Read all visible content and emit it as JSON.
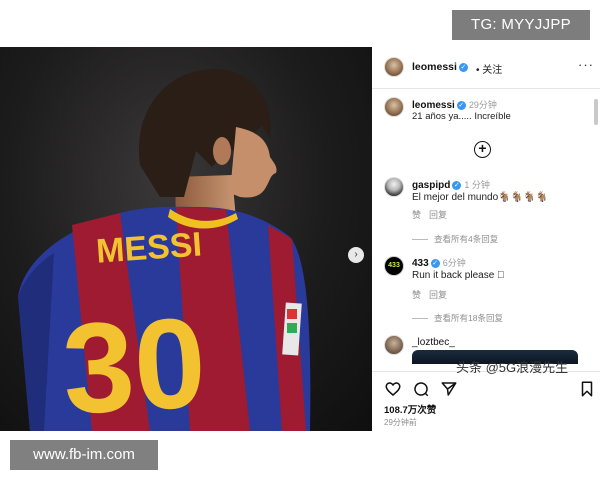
{
  "overlays": {
    "tg_badge": "TG: MYYJJPP",
    "url_badge": "www.fb-im.com",
    "watermark": "头条 @5G浪漫先生"
  },
  "photo": {
    "jersey_name": "MESSI",
    "jersey_number": "30"
  },
  "post": {
    "header_username": "leomessi",
    "header_follow": "• 关注",
    "caption_username": "leomessi",
    "caption_time": "29分钟",
    "caption_text": "21 años ya..... Increíble"
  },
  "comments": [
    {
      "username": "gaspipd",
      "time": "1 分钟",
      "text": "El mejor del mundo🐐🐐🐐🐐",
      "reply_like": "赞",
      "reply": "回复",
      "view_replies": "查看所有4条回复"
    },
    {
      "username": "433",
      "avatar_text": "433",
      "time": "6分钟",
      "text": "Run it back please ⃞",
      "reply_like": "赞",
      "reply": "回复",
      "view_replies": "查看所有18条回复"
    },
    {
      "username": "_loztbec_"
    }
  ],
  "footer": {
    "likes": "108.7万次赞",
    "time_ago": "29分钟前"
  },
  "colors": {
    "verified": "#3897f0",
    "jersey_blue": "#2a3a9a",
    "jersey_red": "#9e1b32",
    "jersey_yellow": "#f2c230"
  }
}
